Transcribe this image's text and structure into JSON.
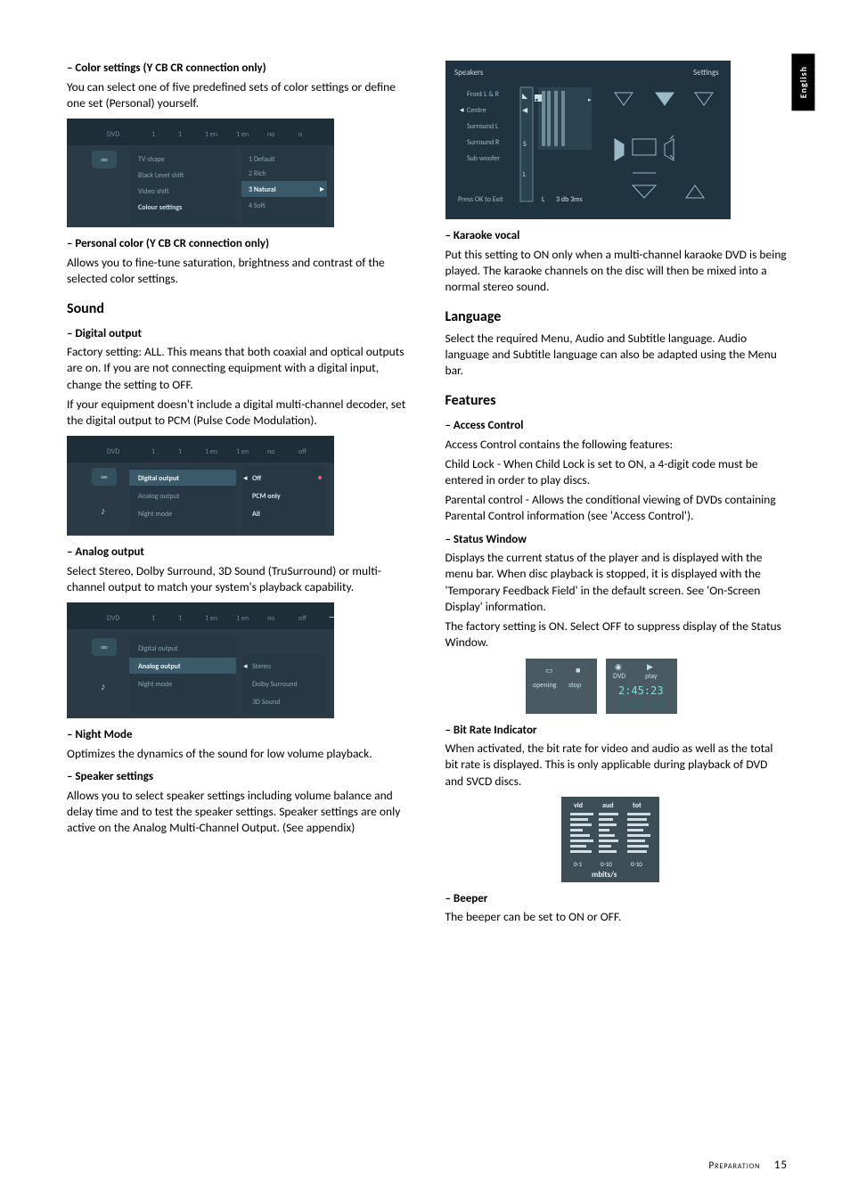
{
  "sideTab": "English",
  "left": {
    "colorHeading": "–  Color settings (Y CB CR connection only)",
    "colorBody": "You can select one of five predefined sets of color settings or define one set (Personal) yourself.",
    "personalHeading": "–  Personal color (Y CB CR connection only)",
    "personalBody": "Allows you to fine-tune saturation, brightness and contrast of the selected color settings.",
    "soundHeading": "Sound",
    "digitalHeading": "–  Digital output",
    "digitalBody1": "Factory setting: ALL. This means that both coaxial and optical outputs are on. If you are not connecting equipment with a digital input, change the setting to OFF.",
    "digitalBody2": "If your equipment doesn't include a digital multi-channel decoder, set the digital output to PCM (Pulse Code Modulation).",
    "analogHeading": "–  Analog output",
    "analogBody": "Select Stereo, Dolby Surround, 3D Sound (TruSurround) or multi-channel output to match your system's playback capability.",
    "nightHeading": "–  Night Mode",
    "nightBody": "Optimizes the dynamics of the sound for low volume playback.",
    "speakerHeading": "–  Speaker settings",
    "speakerBody": "Allows you to select speaker settings including volume balance and delay time and to test the speaker settings. Speaker settings are only active on the Analog Multi-Channel Output. (See appendix)"
  },
  "right": {
    "karaokeHeading": "–  Karaoke vocal",
    "karaokeBody": "Put this setting to ON only when a multi-channel karaoke DVD is being played. The karaoke channels on the disc will then be mixed into a normal stereo sound.",
    "langHeading": "Language",
    "langBody": "Select the required Menu, Audio and Subtitle language. Audio language and Subtitle language can also be adapted using the Menu bar.",
    "featHeading": "Features",
    "accessHeading": "–  Access Control",
    "accessBody1": "Access Control contains the following features:",
    "accessBody2": "Child Lock - When Child Lock is set to ON, a 4-digit code must be entered in order to play discs.",
    "accessBody3": "Parental control - Allows the conditional viewing of DVDs containing Parental Control information (see 'Access Control').",
    "statusHeading": "–  Status Window",
    "statusBody1": "Displays the current status of the player and is displayed with the menu bar.  When disc playback is stopped, it is displayed with the 'Temporary Feedback Field' in the default screen. See 'On-Screen Display' information.",
    "statusBody2": "The factory setting is ON. Select OFF to suppress display of the Status Window.",
    "bitHeading": "–  Bit Rate Indicator",
    "bitBody": "When activated, the bit rate for video and audio as well as the total bit rate is displayed. This is only applicable during playback of DVD and SVCD discs.",
    "beeperHeading": "–  Beeper",
    "beeperBody": "The beeper can be set to ON or OFF."
  },
  "figColor": {
    "topbar": [
      "1",
      "1",
      "1 en",
      "1 en",
      "no",
      "o"
    ],
    "dvd": "DVD",
    "left": [
      "TV shape",
      "Black Level shift",
      "Video shift",
      "Colour settings"
    ],
    "right": [
      "1  Default",
      "2  Rich",
      "3  Natural",
      "4  Soft"
    ],
    "hiIdx": 2
  },
  "figDigital": {
    "topbar": [
      "1",
      "1",
      "1 en",
      "1 en",
      "no",
      "off"
    ],
    "dvd": "DVD",
    "left": [
      "Digital output",
      "Analog output",
      "Night mode"
    ],
    "right": [
      "Off",
      "PCM only",
      "All"
    ],
    "hiLeft": 0
  },
  "figAnalog": {
    "topbar": [
      "1",
      "1",
      "1 en",
      "1 en",
      "no",
      "off"
    ],
    "dvd": "DVD",
    "left": [
      "Digital output",
      "Analog output",
      "Night mode"
    ],
    "right": [
      "Stereo",
      "Dolby Surround",
      "3D Sound"
    ],
    "hiLeft": 1
  },
  "figSpeakers": {
    "title": "Speakers",
    "settings": "Settings",
    "rows": [
      "Front L & R",
      "Centre",
      "Surround L",
      "Surround R",
      "Sub woofer"
    ],
    "exit": "Press OK to Exit",
    "volLabel": "L",
    "volVal": "3 db 3ms",
    "s": "S",
    "l": "L"
  },
  "figStatus": {
    "left": [
      "opening",
      "stop"
    ],
    "right": [
      "DVD",
      "play"
    ],
    "t1": "2:45:23",
    "t2": "0:00:34"
  },
  "figBitrate": {
    "headers": [
      "vid",
      "aud",
      "tot"
    ],
    "ranges": [
      "0-1",
      "0-10",
      "0-10"
    ],
    "unit": "mbits/s"
  },
  "footer": {
    "label": "Preparation",
    "page": "15"
  }
}
